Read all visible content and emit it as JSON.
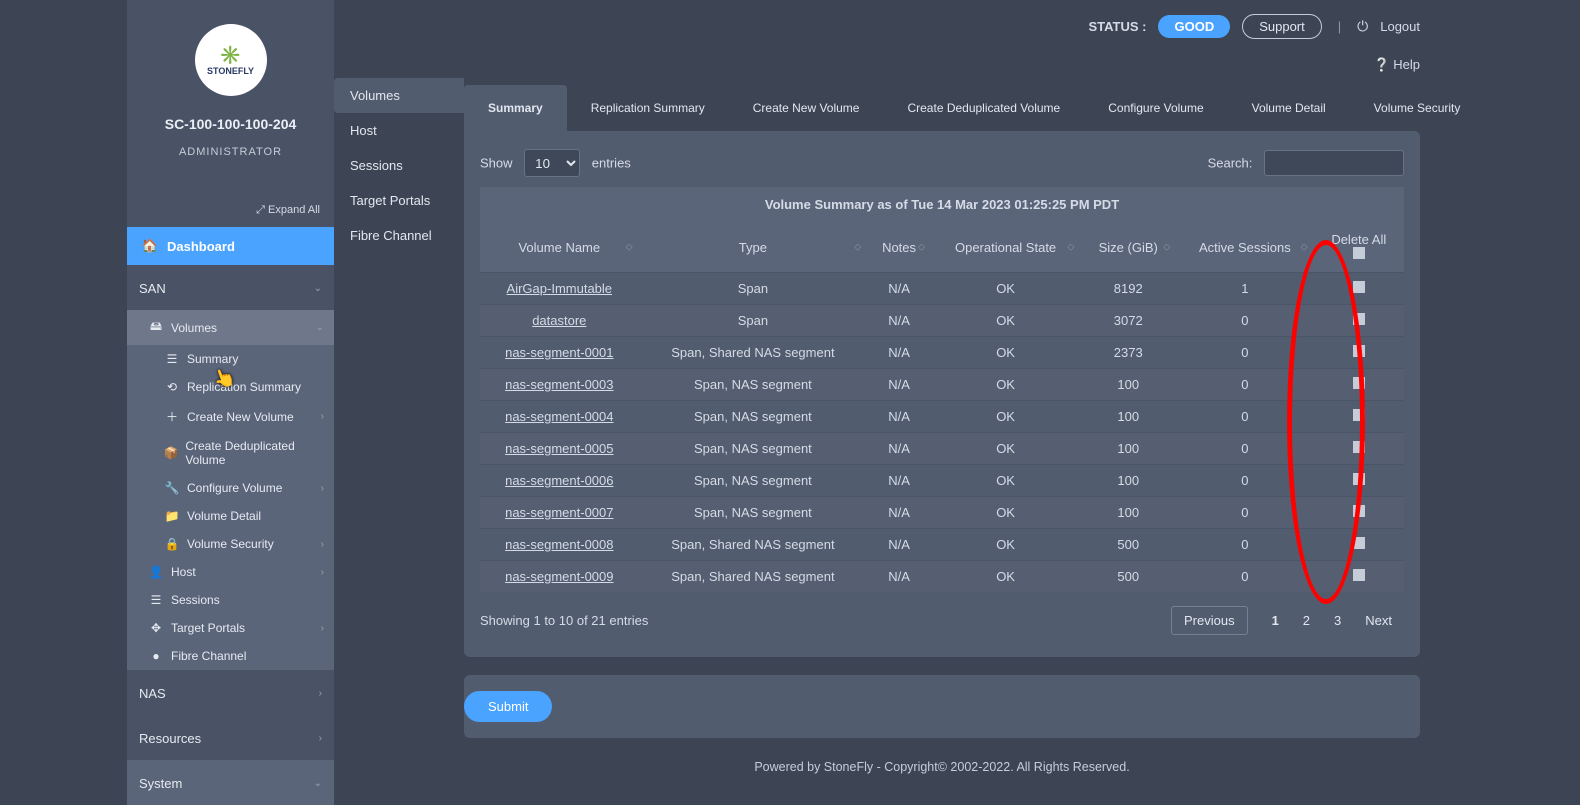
{
  "sidebar": {
    "logo_text": "STONEFLY",
    "host_id": "SC-100-100-100-204",
    "role": "ADMINISTRATOR",
    "expand_all": "Expand All",
    "dashboard": "Dashboard",
    "san_label": "SAN",
    "volumes_label": "Volumes",
    "volumes_children": {
      "summary": "Summary",
      "replication": "Replication Summary",
      "create_new": "Create New Volume",
      "create_dedup": "Create Deduplicated Volume",
      "configure": "Configure Volume",
      "detail": "Volume Detail",
      "security": "Volume Security"
    },
    "host": "Host",
    "sessions": "Sessions",
    "target_portals": "Target Portals",
    "fibre_channel": "Fibre Channel",
    "nas_label": "NAS",
    "resources_label": "Resources",
    "system_label": "System"
  },
  "topbar": {
    "status_label": "STATUS :",
    "status_value": "GOOD",
    "support": "Support",
    "logout": "Logout",
    "help": "Help"
  },
  "menu2": {
    "items": [
      "Volumes",
      "Host",
      "Sessions",
      "Target Portals",
      "Fibre Channel"
    ]
  },
  "tabs": {
    "items": [
      "Summary",
      "Replication Summary",
      "Create New Volume",
      "Create Deduplicated Volume",
      "Configure Volume",
      "Volume Detail",
      "Volume Security"
    ]
  },
  "table_controls": {
    "show_label": "Show",
    "entries_label": "entries",
    "page_size": "10",
    "search_label": "Search:"
  },
  "caption": "Volume Summary as of Tue 14 Mar 2023 01:25:25 PM PDT",
  "columns": {
    "name": "Volume Name",
    "type": "Type",
    "notes": "Notes",
    "op_state": "Operational State",
    "size": "Size (GiB)",
    "sessions": "Active Sessions",
    "delete_all": "Delete All"
  },
  "rows": [
    {
      "name": "AirGap-Immutable",
      "type": "Span",
      "notes": "N/A",
      "state": "OK",
      "size": "8192",
      "sessions": "1"
    },
    {
      "name": "datastore",
      "type": "Span",
      "notes": "N/A",
      "state": "OK",
      "size": "3072",
      "sessions": "0"
    },
    {
      "name": "nas-segment-0001",
      "type": "Span, Shared NAS segment",
      "notes": "N/A",
      "state": "OK",
      "size": "2373",
      "sessions": "0"
    },
    {
      "name": "nas-segment-0003",
      "type": "Span, NAS segment",
      "notes": "N/A",
      "state": "OK",
      "size": "100",
      "sessions": "0"
    },
    {
      "name": "nas-segment-0004",
      "type": "Span, NAS segment",
      "notes": "N/A",
      "state": "OK",
      "size": "100",
      "sessions": "0"
    },
    {
      "name": "nas-segment-0005",
      "type": "Span, NAS segment",
      "notes": "N/A",
      "state": "OK",
      "size": "100",
      "sessions": "0"
    },
    {
      "name": "nas-segment-0006",
      "type": "Span, NAS segment",
      "notes": "N/A",
      "state": "OK",
      "size": "100",
      "sessions": "0"
    },
    {
      "name": "nas-segment-0007",
      "type": "Span, NAS segment",
      "notes": "N/A",
      "state": "OK",
      "size": "100",
      "sessions": "0"
    },
    {
      "name": "nas-segment-0008",
      "type": "Span, Shared NAS segment",
      "notes": "N/A",
      "state": "OK",
      "size": "500",
      "sessions": "0"
    },
    {
      "name": "nas-segment-0009",
      "type": "Span, Shared NAS segment",
      "notes": "N/A",
      "state": "OK",
      "size": "500",
      "sessions": "0"
    }
  ],
  "table_footer": {
    "info": "Showing 1 to 10 of 21 entries",
    "prev": "Previous",
    "pages": [
      "1",
      "2",
      "3"
    ],
    "next": "Next"
  },
  "submit": "Submit",
  "footer": "Powered by StoneFly - Copyright© 2002-2022. All Rights Reserved."
}
